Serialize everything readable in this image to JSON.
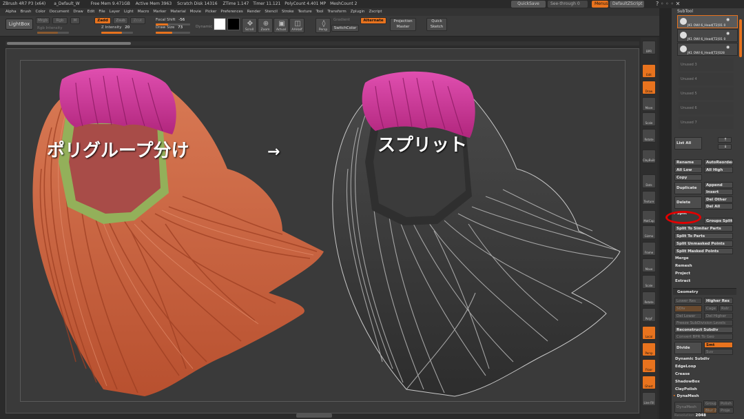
{
  "titlebar": {
    "app": "ZBrush 4R7 P3 (x64)",
    "doc": "a_Default_W",
    "free_mem": "Free Mem 9.471GB",
    "active_mem": "Active Mem 3963",
    "scratch_disk": "Scratch Disk 14316",
    "ztime": "ZTime 1.147",
    "timer": "Timer 11.121",
    "polycount": "PolyCount 4.401 MP",
    "meshcount": "MeshCount 2",
    "quicksave": "QuickSave",
    "see_through": "See-through",
    "see_through_value": "0",
    "menus": "Menus",
    "script": "DefaultZScript"
  },
  "menubar": [
    "Alpha",
    "Brush",
    "Color",
    "Document",
    "Draw",
    "Edit",
    "File",
    "Layer",
    "Light",
    "Macro",
    "Marker",
    "Material",
    "Movie",
    "Picker",
    "Preferences",
    "Render",
    "Stencil",
    "Stroke",
    "Texture",
    "Tool",
    "Transform",
    "Zplugin",
    "Zscript"
  ],
  "toolbar": {
    "lightbox": "LightBox",
    "mrgb": "Mrgb",
    "rgb": "Rgb",
    "m": "M",
    "zadd": "Zadd",
    "zsub": "Zsub",
    "zcut": "Zcut",
    "rgb_intensity": "Rgb Intensity",
    "z_intensity_label": "Z Intensity",
    "z_intensity_value": "20",
    "focal_shift_label": "Focal Shift",
    "focal_shift_value": "-56",
    "draw_size_label": "Draw Size",
    "draw_size_value": "73",
    "dynamic": "Dynamic",
    "scroll": "Scroll",
    "zoom": "Zoom",
    "actual": "Actual",
    "aahalf": "AAHalf",
    "dynamic_persp": "Persp",
    "gradient": "Gradient",
    "switchcolor": "SwitchColor",
    "alternate": "Alternate",
    "projection_master": "Projection Master",
    "quick_sketch": "Quick Sketch"
  },
  "canvas": {
    "label_left": "ポリグループ分け",
    "arrow": "→",
    "label_right": "スプリット"
  },
  "shelf": [
    "BPR",
    "SPix 3",
    "Edit",
    "Draw",
    "Move",
    "Scale",
    "Rotate",
    "ClayBuildup",
    "Dots",
    "Alpha Off",
    "Texture Off",
    "MatCap Red Wax",
    "Gizmo",
    "Frame",
    "Move",
    "Scale",
    "Rotate",
    "PolyF",
    "Solo",
    "Transp",
    "Local",
    "Persp",
    "Floor",
    "Ghost",
    "Line Fill"
  ],
  "subtool": {
    "title": "SubTool",
    "items": [
      {
        "name": "JK1 OWI 6_Head[T2]01 0",
        "active": true
      },
      {
        "name": "JK1 OWI 6_Head[T2]01 0",
        "active": false
      },
      {
        "name": "JK1 OWI 6_Head[T2]028",
        "active": false
      }
    ],
    "unused": [
      "Unused 3",
      "Unused 4",
      "Unused 5",
      "Unused 6",
      "Unused 7"
    ],
    "list_all": "List All",
    "rename": "Rename",
    "autoreorder": "AutoReorder",
    "all_low": "All Low",
    "all_high": "All High",
    "copy": "Copy",
    "duplicate": "Duplicate",
    "append": "Append",
    "insert": "Insert",
    "delete": "Delete",
    "del_other": "Del Other",
    "del_all": "Del All",
    "split": "Split",
    "groups_split": "Groups Split",
    "split_similar": "Split To Similar Parts",
    "split_parts": "Split To Parts",
    "split_unmasked": "Split Unmasked Points",
    "split_masked": "Split Masked Points",
    "merge": "Merge",
    "remesh": "Remesh",
    "project": "Project",
    "extract": "Extract"
  },
  "geometry": {
    "title": "Geometry",
    "lower_res": "Lower Res",
    "higher_res": "Higher Res",
    "sdiv": "SDiv",
    "cage": "Cage",
    "rstr": "Rstr",
    "del_lower": "Del Lower",
    "del_higher": "Del Higher",
    "freeze_subdiv": "Freeze SubDivision Levels",
    "reconstruct_subdiv": "Reconstruct Subdiv",
    "convert_bpr": "Convert BPR To Geo",
    "divide": "Divide",
    "smt": "Smt",
    "suv": "Suv",
    "dynamic_subdiv": "Dynamic Subdiv",
    "edgeloop": "EdgeLoop",
    "crease": "Crease",
    "shadowbox": "ShadowBox",
    "claypolish": "ClayPolish",
    "dynamesh": "DynaMesh",
    "dynamesh_btn": "DynaMesh",
    "group": "Group",
    "polish": "Polish",
    "blur": "Blur",
    "blur_value": "2",
    "project": "Proje",
    "resolution_label": "Resolution",
    "resolution_value": "2048"
  },
  "colors": {
    "accent": "#e8731e",
    "highlight_circle": "#e20000",
    "hair_orange": "#d06a48",
    "hair_pink": "#d13b9a",
    "hair_gray": "#3a3a3a"
  }
}
